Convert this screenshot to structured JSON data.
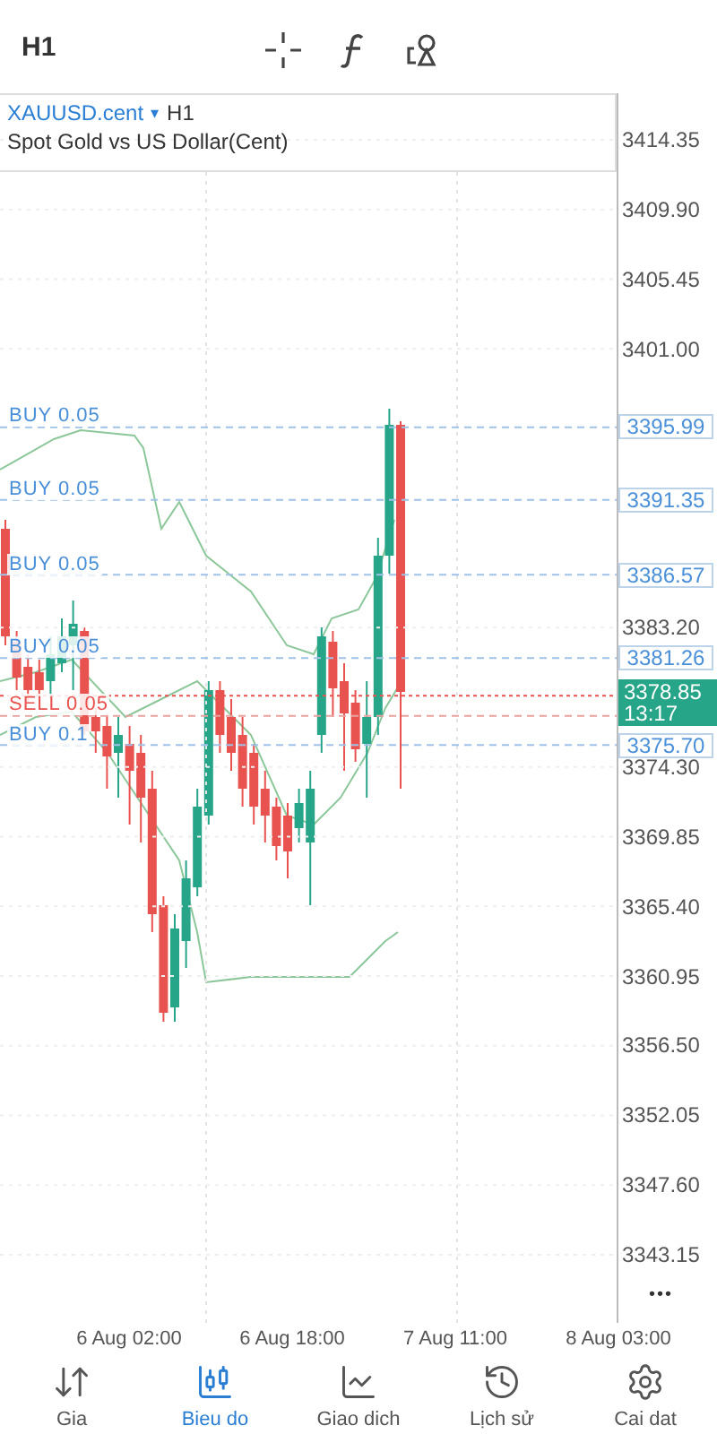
{
  "header": {
    "timeframe": "H1"
  },
  "symbol": {
    "name": "XAUUSD.cent",
    "caret": "▾",
    "timeframe": "H1",
    "description": "Spot Gold vs US Dollar(Cent)"
  },
  "price_ticks": [
    "3414.35",
    "3409.90",
    "3405.45",
    "3401.00",
    "3383.20",
    "3374.30",
    "3369.85",
    "3365.40",
    "3360.95",
    "3356.50",
    "3352.05",
    "3347.60",
    "3343.15"
  ],
  "orders": [
    {
      "kind": "buy",
      "label": "BUY 0.05",
      "price": "3395.99"
    },
    {
      "kind": "buy",
      "label": "BUY 0.05",
      "price": "3391.35"
    },
    {
      "kind": "buy",
      "label": "BUY 0.05",
      "price": "3386.57"
    },
    {
      "kind": "buy",
      "label": "BUY 0.05",
      "price": "3381.26"
    },
    {
      "kind": "sell",
      "label": "SELL 0.05"
    },
    {
      "kind": "buy",
      "label": "BUY 0.1",
      "price": "3375.70"
    }
  ],
  "current": {
    "price": "3378.85",
    "countdown": "13:17"
  },
  "more": "•••",
  "time_labels": [
    "6 Aug 02:00",
    "6 Aug 18:00",
    "7 Aug 11:00",
    "8 Aug 03:00"
  ],
  "tabs": [
    {
      "kind": "quotes",
      "label": "Gia",
      "selected": false
    },
    {
      "kind": "chart",
      "label": "Bieu do",
      "selected": true
    },
    {
      "kind": "trade",
      "label": "Giao dich",
      "selected": false
    },
    {
      "kind": "history",
      "label": "Lịch sử",
      "selected": false
    },
    {
      "kind": "settings",
      "label": "Cai dat",
      "selected": false
    }
  ]
}
